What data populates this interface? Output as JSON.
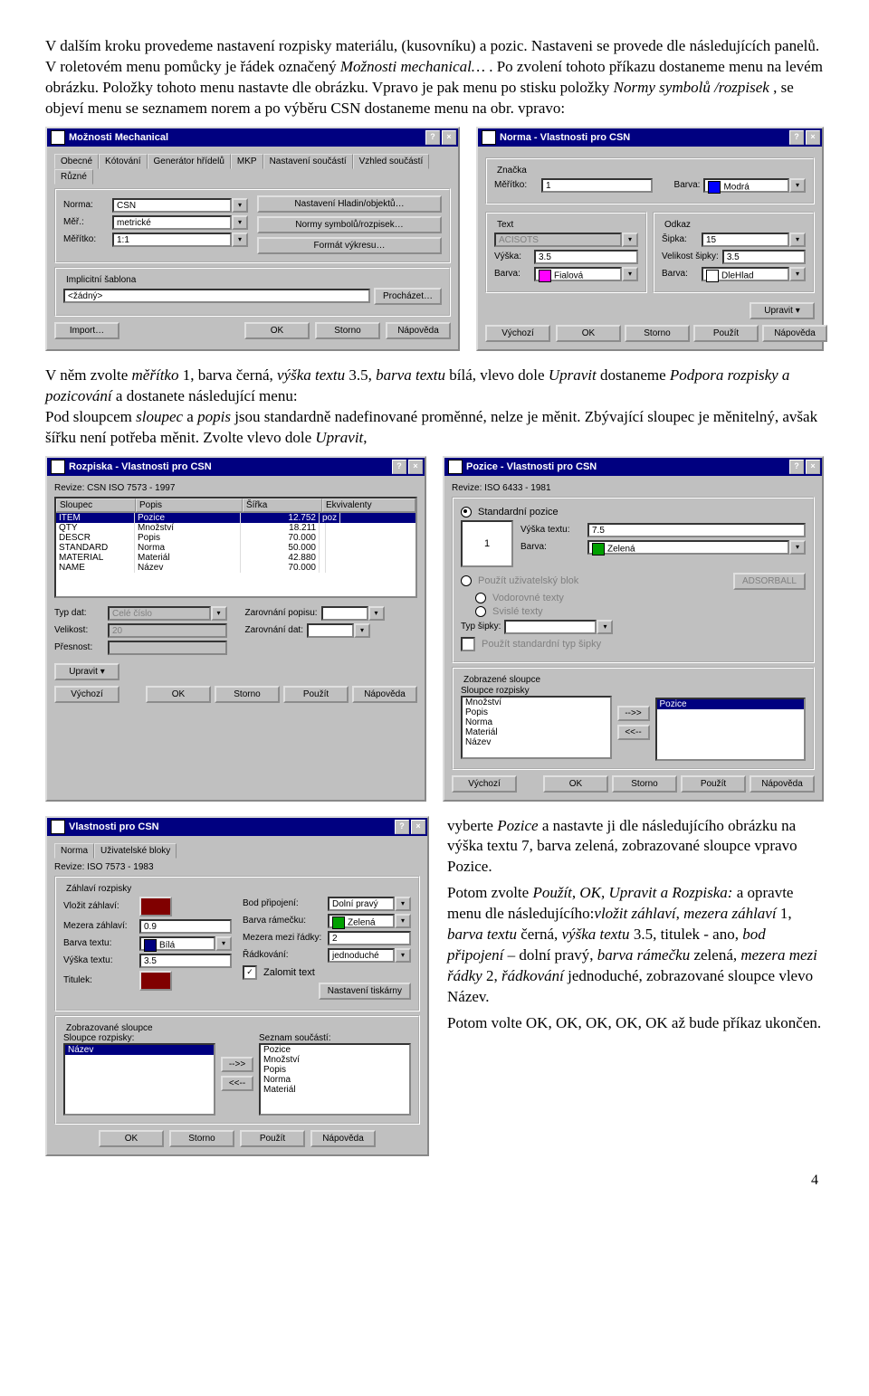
{
  "para1": {
    "l1a": "V dalším kroku provedeme nastavení rozpisky materiálu, (kusovníku) a pozic. Nastaveni se provede dle následujících panelů. V roletovém menu pomůcky je řádek označený ",
    "l1b": "Možnosti mechanical…",
    "l1c": ". Po zvolení tohoto příkazu dostaneme menu na levém obrázku. Položky tohoto menu nastavte dle obrázku. Vpravo je pak menu po stisku položky ",
    "l1d": "Normy symbolů /rozpisek",
    "l1e": ", se objeví menu se seznamem norem a po výběru CSN dostaneme menu na obr. vpravo:"
  },
  "para2": {
    "a": "V něm zvolte ",
    "b": "měřítko",
    "c": " 1, barva černá, ",
    "d": "výška textu",
    "e": " 3.5, ",
    "f": "barva textu",
    "g": " bílá, vlevo dole ",
    "h": "Upravit",
    "i": " dostaneme ",
    "j": "Podpora rozpisky a pozicování",
    "k": " a dostanete následující menu:",
    "l": "Pod sloupcem ",
    "m": "sloupec",
    "n": " a ",
    "o": "popis",
    "p": " jsou standardně nadefinované proměnné, nelze je měnit. Zbývající sloupec je měnitelný, avšak šířku není potřeba měnit. Zvolte vlevo dole ",
    "q": "Upravit",
    "r": ","
  },
  "dlg1": {
    "title": "Možnosti Mechanical",
    "tabs": [
      "Obecné",
      "Kótování",
      "Generátor hřídelů",
      "MKP",
      "Nastavení součástí",
      "Vzhled součástí",
      "Různé"
    ],
    "norma_l": "Norma:",
    "norma_v": "CSN",
    "mer_l": "Měř.:",
    "mer_v": "metrické",
    "meritko_l": "Měřítko:",
    "meritko_v": "1:1",
    "btn1": "Nastavení Hladin/objektů…",
    "btn2": "Normy symbolů/rozpisek…",
    "btn3": "Formát výkresu…",
    "group_l": "Implicitní šablona",
    "tmpl_v": "<žádný>",
    "btn4": "Procházet…",
    "btn_import": "Import…",
    "b_ok": "OK",
    "b_storno": "Storno",
    "b_nap": "Nápověda"
  },
  "dlg2": {
    "title": "Norma - Vlastnosti pro CSN",
    "znacka_l": "Značka",
    "meritko_l": "Měřítko:",
    "meritko_v": "1",
    "barva_l": "Barva:",
    "barva_v": "Modrá",
    "barva_c": "#0000ff",
    "text_l": "Text",
    "font_l": "",
    "font_v": "ACISOTS",
    "odkaz_l": "Odkaz",
    "sipka_l": "Šipka:",
    "sipka_v": "15",
    "vyska_l": "Výška:",
    "vyska_v": "3.5",
    "velsip_l": "Velikost šipky:",
    "velsip_v": "3.5",
    "barvat_l": "Barva:",
    "barvat_v": "Fialová",
    "barvat_c": "#ff00ff",
    "barvao_l": "Barva:",
    "barvao_v": "DleHlad",
    "btn_up": "Upravit ▾",
    "btn_vy": "Výchozí",
    "b_ok": "OK",
    "b_storno": "Storno",
    "b_pouzit": "Použít",
    "b_nap": "Nápověda"
  },
  "dlg3": {
    "title": "Rozpiska - Vlastnosti pro CSN",
    "revize_l": "Revize: CSN ISO 7573 - 1997",
    "hdr": [
      "Sloupec",
      "Popis",
      "Šířka",
      "Ekvivalenty"
    ],
    "rows": [
      [
        "ITEM",
        "Pozice",
        "12.752",
        "poz"
      ],
      [
        "QTY",
        "Množství",
        "18.211",
        ""
      ],
      [
        "DESCR",
        "Popis",
        "70.000",
        ""
      ],
      [
        "STANDARD",
        "Norma",
        "50.000",
        ""
      ],
      [
        "MATERIAL",
        "Materiál",
        "42.880",
        ""
      ],
      [
        "NAME",
        "Název",
        "70.000",
        ""
      ]
    ],
    "typ_l": "Typ dat:",
    "typ_v": "Celé číslo",
    "vel_l": "Velikost:",
    "vel_v": "20",
    "pres_l": "Přesnost:",
    "pres_v": "",
    "zar1_l": "Zarovnání popisu:",
    "zar1_v": "",
    "zar2_l": "Zarovnání dat:",
    "zar2_v": "",
    "btn_up": "Upravit ▾",
    "btn_vy": "Výchozí",
    "b_ok": "OK",
    "b_storno": "Storno",
    "b_pouzit": "Použít",
    "b_nap": "Nápověda"
  },
  "dlg4": {
    "title": "Pozice - Vlastnosti pro CSN",
    "revize_l": "Revize: ISO 6433 - 1981",
    "std_l": "Standardní pozice",
    "vyt_l": "Výška textu:",
    "vyt_v": "7.5",
    "bar_l": "Barva:",
    "bar_v": "Zelená",
    "bar_c": "#00a000",
    "uziv_l": "Použít uživatelský blok",
    "uziv_b": "ADSORBALL",
    "vod_l": "Vodorovné texty",
    "svis_l": "Svislé texty",
    "typs_l": "Typ šipky:",
    "typs_v": "",
    "chk_l": "Použít standardní typ šipky",
    "zobr_l": "Zobrazené sloupce",
    "left_l": "Sloupce rozpisky",
    "left_items": [
      "Množství",
      "Popis",
      "Norma",
      "Materiál",
      "Název"
    ],
    "right_l": "",
    "right_items": [
      "Pozice"
    ],
    "btn_add": "-->>",
    "btn_rem": "<<--",
    "btn_vy": "Výchozí",
    "b_ok": "OK",
    "b_storno": "Storno",
    "b_pouzit": "Použít",
    "b_nap": "Nápověda"
  },
  "dlg5": {
    "title": "Vlastnosti pro CSN",
    "tabs": [
      "Norma",
      "Uživatelské bloky"
    ],
    "revize_l": "Revize: ISO 7573 - 1983",
    "grp_l": "Záhlaví rozpisky",
    "vloz_l": "Vložit záhlaví:",
    "mez_l": "Mezera záhlaví:",
    "mez_v": "0.9",
    "bt_l": "Barva textu:",
    "bt_v": "Bílá",
    "bt_c": "#ffffff",
    "vt_l": "Výška textu:",
    "vt_v": "3.5",
    "tit_l": "Titulek:",
    "bp_l": "Bod připojení:",
    "bp_v": "Dolní pravý",
    "br_l": "Barva rámečku:",
    "br_v": "Zelená",
    "br_c": "#00a000",
    "mr_l": "Mezera mezi řádky:",
    "mr_v": "2",
    "rad_l": "Řádkování:",
    "rad_v": "jednoduché",
    "zal_l": "Zalomit text",
    "btn_tisk": "Nastavení tiskárny",
    "zobr_l": "Zobrazované sloupce",
    "sloup_l": "Sloupce rozpisky:",
    "left_items": [
      "Název"
    ],
    "sezn_l": "Seznam součástí:",
    "right_items": [
      "Pozice",
      "Množství",
      "Popis",
      "Norma",
      "Materiál"
    ],
    "btn_add": "-->>",
    "btn_rem": "<<--",
    "b_ok": "OK",
    "b_storno": "Storno",
    "b_pouzit": "Použít",
    "b_nap": "Nápověda"
  },
  "para3": {
    "a": "vyberte ",
    "b": "Pozice",
    "c": " a nastavte ji dle následujícího obrázku na výška textu 7, barva zelená, zobrazované sloupce vpravo Pozice.",
    "d": "Potom zvolte ",
    "e": "Použít, OK, Upravit a Rozpiska:",
    "f": " a opravte menu dle následujícího:",
    "g": "vložit záhlaví",
    "h": ", ",
    "i": "mezera záhlaví",
    "j": " 1, ",
    "k": "barva textu",
    "l": " černá, ",
    "m": "výška textu",
    "n": " 3.5, titulek - ano, ",
    "o": "bod připojení",
    "p": " – dolní pravý, ",
    "q": "barva rámečku",
    "r": " zelená, ",
    "s": "mezera mezi řádky",
    "t": " 2, ",
    "u": "řádkování",
    "v": " jednoduché, zobrazované sloupce vlevo Název.",
    "w": "Potom volte OK, OK, OK, OK, OK až bude příkaz ukončen."
  },
  "pagenum": "4"
}
